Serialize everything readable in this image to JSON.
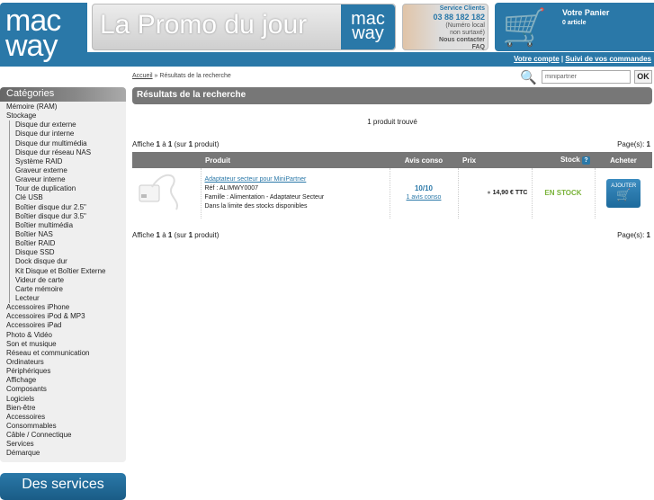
{
  "header": {
    "logo": [
      "mac",
      "way"
    ],
    "promo": "La Promo du jour",
    "promo_logo": [
      "mac",
      "way"
    ],
    "service": {
      "title": "Service Clients",
      "phone": "03 88 182 182",
      "note1": "(Numéro local",
      "note2": "non surtaxé)",
      "contact": "Nous contacter",
      "faq": "FAQ"
    },
    "cart": {
      "title": "Votre Panier",
      "count": "0 article"
    },
    "account": "Votre compte",
    "orders": "Suivi de vos commandes",
    "sep": "|"
  },
  "breadcrumb": {
    "home": "Accueil",
    "sep": "»",
    "current": "Résultats de la recherche"
  },
  "search": {
    "value": "minipartner",
    "ok": "OK"
  },
  "sidebar": {
    "title": "Catégories",
    "items": [
      {
        "label": "Mémoire (RAM)",
        "sub": false
      },
      {
        "label": "Stockage",
        "sub": false
      },
      {
        "label": "Disque dur externe",
        "sub": true
      },
      {
        "label": "Disque dur interne",
        "sub": true
      },
      {
        "label": "Disque dur multimédia",
        "sub": true
      },
      {
        "label": "Disque dur réseau NAS",
        "sub": true
      },
      {
        "label": "Système RAID",
        "sub": true
      },
      {
        "label": "Graveur externe",
        "sub": true
      },
      {
        "label": "Graveur interne",
        "sub": true
      },
      {
        "label": "Tour de duplication",
        "sub": true
      },
      {
        "label": "Clé USB",
        "sub": true
      },
      {
        "label": "Boîtier disque dur 2.5\"",
        "sub": true
      },
      {
        "label": "Boîtier disque dur 3.5\"",
        "sub": true
      },
      {
        "label": "Boîtier multimédia",
        "sub": true
      },
      {
        "label": "Boîtier NAS",
        "sub": true
      },
      {
        "label": "Boîtier RAID",
        "sub": true
      },
      {
        "label": "Disque SSD",
        "sub": true
      },
      {
        "label": "Dock disque dur",
        "sub": true
      },
      {
        "label": "Kit Disque et Boîtier Externe",
        "sub": true
      },
      {
        "label": "Videur de carte",
        "sub": true
      },
      {
        "label": "Carte mémoire",
        "sub": true
      },
      {
        "label": "Lecteur",
        "sub": true
      },
      {
        "label": "Accessoires iPhone",
        "sub": false
      },
      {
        "label": "Accessoires iPod & MP3",
        "sub": false
      },
      {
        "label": "Accessoires iPad",
        "sub": false
      },
      {
        "label": "Photo & Vidéo",
        "sub": false
      },
      {
        "label": "Son et musique",
        "sub": false
      },
      {
        "label": "Réseau et communication",
        "sub": false
      },
      {
        "label": "Ordinateurs",
        "sub": false
      },
      {
        "label": "Périphériques",
        "sub": false
      },
      {
        "label": "Affichage",
        "sub": false
      },
      {
        "label": "Composants",
        "sub": false
      },
      {
        "label": "Logiciels",
        "sub": false
      },
      {
        "label": "Bien-être",
        "sub": false
      },
      {
        "label": "Accessoires",
        "sub": false
      },
      {
        "label": "Consommables",
        "sub": false
      },
      {
        "label": "Câble / Connectique",
        "sub": false
      },
      {
        "label": "Services",
        "sub": false
      },
      {
        "label": "Démarque",
        "sub": false
      }
    ],
    "services_banner": "Des services"
  },
  "main": {
    "title": "Résultats de la recherche",
    "found": "1 produit trouvé",
    "pager": {
      "a": "Affiche ",
      "from": "1",
      "b": " à ",
      "to": "1",
      "c": " (sur ",
      "total": "1",
      "d": " produit)",
      "pages_label": "Page(s): ",
      "page": "1"
    },
    "columns": [
      "Produit",
      "Avis conso",
      "Prix",
      "Stock",
      "Acheter"
    ],
    "stock_help": "?",
    "product": {
      "name": "Adaptateur secteur pour MiniPartner",
      "ref": "Réf : ALIMWY0007",
      "family": "Famille : Alimentation - Adaptateur Secteur",
      "limit": "Dans la limite des stocks disponibles",
      "rating": "10/10",
      "reviews": "1 avis conso",
      "price": "14,90 € TTC",
      "stock": "EN STOCK",
      "add": "AJOUTER"
    }
  }
}
